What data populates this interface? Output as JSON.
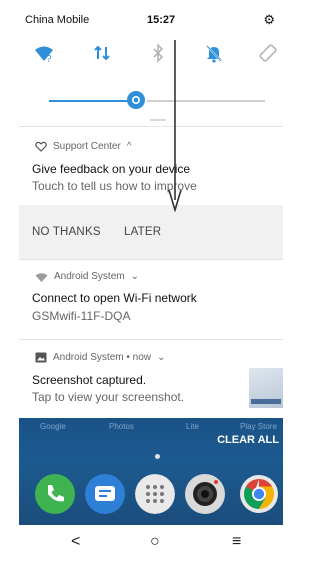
{
  "status_bar": {
    "carrier": "China Mobile",
    "time": "15:27"
  },
  "notifications": [
    {
      "app": "Support Center",
      "expand": "^",
      "title": "Give feedback on your device",
      "text": "Touch to tell us how to improve",
      "actions": [
        "NO THANKS",
        "LATER"
      ]
    },
    {
      "app": "Android System",
      "expand": "⌄",
      "title": "Connect to open Wi-Fi network",
      "text": "GSMwifi-11F-DQA"
    },
    {
      "app": "Android System • now",
      "expand": "⌄",
      "title": "Screenshot captured.",
      "text": "Tap to view your screenshot."
    }
  ],
  "background_apps": [
    "Google",
    "Photos",
    "Lite",
    "Play Store"
  ],
  "clear_all_label": "CLEAR ALL",
  "nav": {
    "back": "<",
    "home": "○",
    "recents": "≡"
  },
  "colors": {
    "accent": "#2f8fd8",
    "wallpaper": "#1b4d7c"
  }
}
